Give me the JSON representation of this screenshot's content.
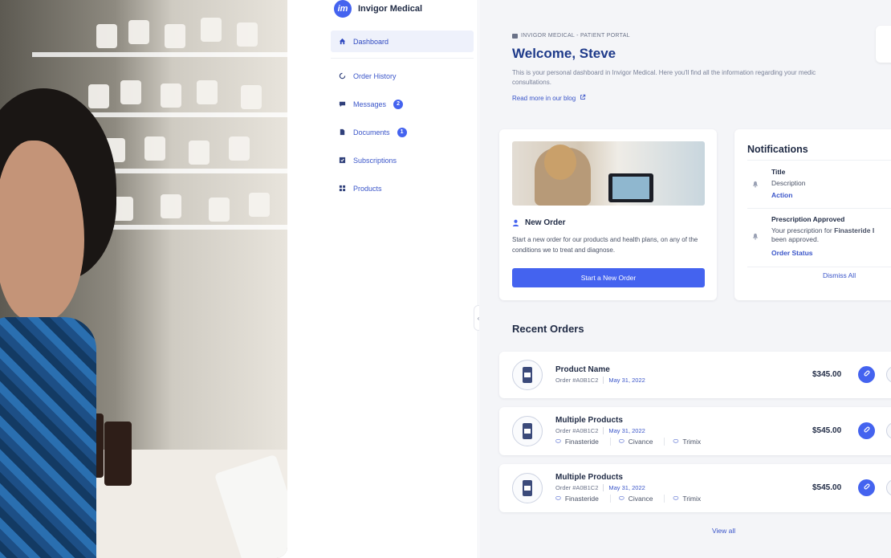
{
  "brand": {
    "name": "Invigor Medical",
    "logo_text": "im"
  },
  "sidebar": {
    "items": [
      {
        "label": "Dashboard",
        "icon": "home-icon",
        "active": true,
        "badge": ""
      },
      {
        "label": "Order History",
        "icon": "refresh-icon",
        "badge": ""
      },
      {
        "label": "Messages",
        "icon": "chat-icon",
        "badge": "2"
      },
      {
        "label": "Documents",
        "icon": "document-icon",
        "badge": "1"
      },
      {
        "label": "Subscriptions",
        "icon": "subscription-icon",
        "badge": ""
      },
      {
        "label": "Products",
        "icon": "grid-icon",
        "badge": ""
      }
    ]
  },
  "header": {
    "breadcrumb": "INVIGOR MEDICAL - PATIENT PORTAL",
    "welcome": "Welcome, Steve",
    "intro_line1": "This is your personal dashboard in Invigor Medical. Here you'll find all the information regarding your medic",
    "intro_line2": "consultations.",
    "blog_link": "Read more in our blog"
  },
  "new_order": {
    "title": "New Order",
    "description": "Start a new order for our products and health plans, on any of the conditions we to treat and diagnose.",
    "button": "Start a New Order"
  },
  "notifications": {
    "title": "Notifications",
    "items": [
      {
        "title": "Title",
        "description": "Description",
        "action": "Action"
      },
      {
        "title": "Prescription Approved",
        "description_line1_prefix": "Your prescription for ",
        "description_line1_bold": "Finasteride I",
        "description_line2": "been approved.",
        "action": "Order Status"
      }
    ],
    "dismiss": "Dismiss All"
  },
  "recent_orders": {
    "title": "Recent Orders",
    "rows": [
      {
        "name": "Product Name",
        "order": "Order #A0B1C2",
        "date": "May 31, 2022",
        "price": "$345.00",
        "tags": []
      },
      {
        "name": "Multiple Products",
        "order": "Order #A0B1C2",
        "date": "May 31, 2022",
        "price": "$545.00",
        "tags": [
          "Finasteride",
          "Civance",
          "Trimix"
        ]
      },
      {
        "name": "Multiple Products",
        "order": "Order #A0B1C2",
        "date": "May 31, 2022",
        "price": "$545.00",
        "tags": [
          "Finasteride",
          "Civance",
          "Trimix"
        ]
      }
    ],
    "view_all": "View all"
  },
  "colors": {
    "accent": "#4463ef",
    "heading": "#1e3a8a",
    "background": "#f4f5f8"
  }
}
